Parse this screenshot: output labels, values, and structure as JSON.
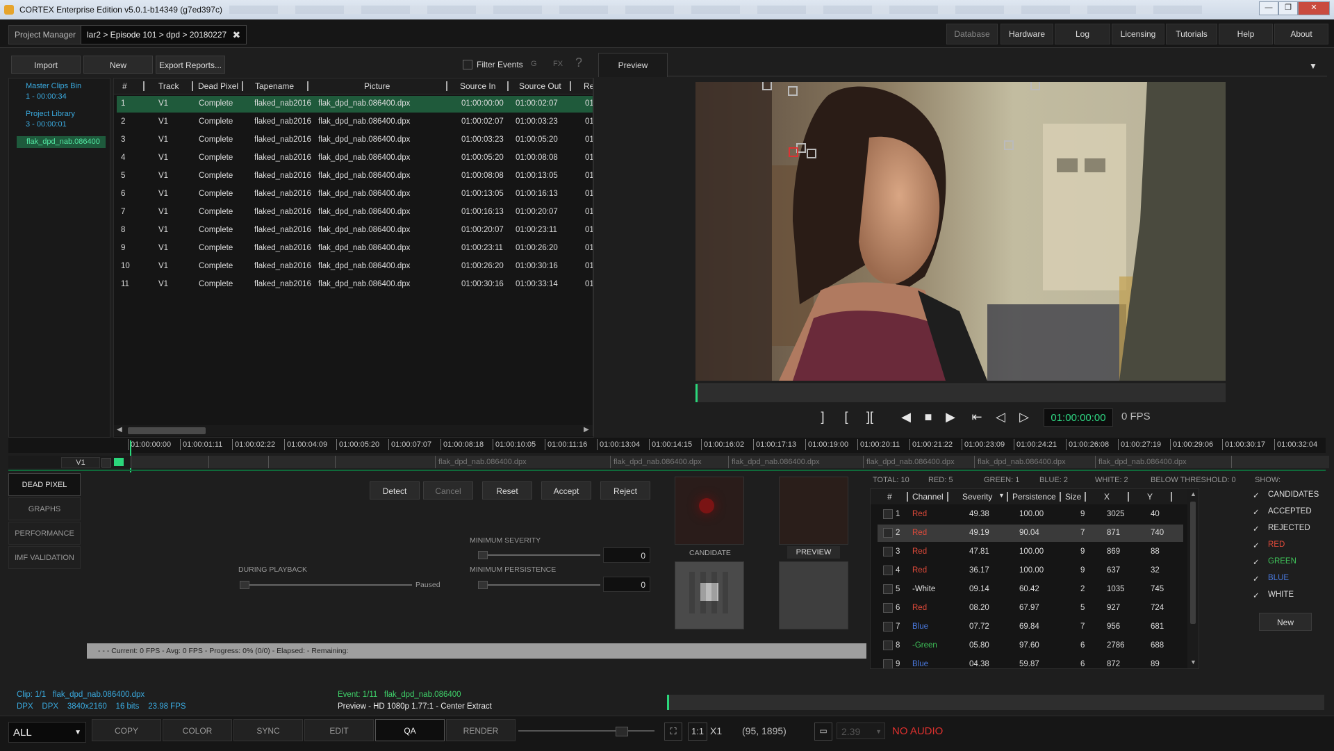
{
  "window": {
    "title": "CORTEX Enterprise Edition v5.0.1-b14349 (g7ed397c)"
  },
  "tabs": {
    "project_manager": "Project Manager",
    "episode": "lar2 > Episode 101 > dpd > 20180227",
    "close": "✖"
  },
  "nav": [
    "Database",
    "Hardware",
    "Log",
    "Licensing",
    "Tutorials",
    "Help",
    "About"
  ],
  "toolbar": {
    "import": "Import",
    "new": "New",
    "export": "Export Reports...",
    "filter_events": "Filter Events",
    "g": "G",
    "fx": "FX",
    "help": "?"
  },
  "bins": [
    {
      "name": "Master Clips Bin",
      "count": "1 - 00:00:34"
    },
    {
      "name": "Project Library",
      "count": "3 - 00:00:01"
    }
  ],
  "selected_bin": "flak_dpd_nab.086400",
  "table": {
    "columns": [
      "#",
      "Track",
      "Dead Pixel",
      "Tapename",
      "Picture",
      "Source In",
      "Source Out",
      "Re"
    ],
    "rows": [
      {
        "n": "1",
        "track": "V1",
        "status": "Complete",
        "tape": "flaked_nab2016",
        "picture": "flak_dpd_nab.086400.dpx",
        "in": "01:00:00:00",
        "out": "01:00:02:07",
        "re": "01:"
      },
      {
        "n": "2",
        "track": "V1",
        "status": "Complete",
        "tape": "flaked_nab2016",
        "picture": "flak_dpd_nab.086400.dpx",
        "in": "01:00:02:07",
        "out": "01:00:03:23",
        "re": "01:"
      },
      {
        "n": "3",
        "track": "V1",
        "status": "Complete",
        "tape": "flaked_nab2016",
        "picture": "flak_dpd_nab.086400.dpx",
        "in": "01:00:03:23",
        "out": "01:00:05:20",
        "re": "01:"
      },
      {
        "n": "4",
        "track": "V1",
        "status": "Complete",
        "tape": "flaked_nab2016",
        "picture": "flak_dpd_nab.086400.dpx",
        "in": "01:00:05:20",
        "out": "01:00:08:08",
        "re": "01:"
      },
      {
        "n": "5",
        "track": "V1",
        "status": "Complete",
        "tape": "flaked_nab2016",
        "picture": "flak_dpd_nab.086400.dpx",
        "in": "01:00:08:08",
        "out": "01:00:13:05",
        "re": "01:"
      },
      {
        "n": "6",
        "track": "V1",
        "status": "Complete",
        "tape": "flaked_nab2016",
        "picture": "flak_dpd_nab.086400.dpx",
        "in": "01:00:13:05",
        "out": "01:00:16:13",
        "re": "01:"
      },
      {
        "n": "7",
        "track": "V1",
        "status": "Complete",
        "tape": "flaked_nab2016",
        "picture": "flak_dpd_nab.086400.dpx",
        "in": "01:00:16:13",
        "out": "01:00:20:07",
        "re": "01:"
      },
      {
        "n": "8",
        "track": "V1",
        "status": "Complete",
        "tape": "flaked_nab2016",
        "picture": "flak_dpd_nab.086400.dpx",
        "in": "01:00:20:07",
        "out": "01:00:23:11",
        "re": "01:"
      },
      {
        "n": "9",
        "track": "V1",
        "status": "Complete",
        "tape": "flaked_nab2016",
        "picture": "flak_dpd_nab.086400.dpx",
        "in": "01:00:23:11",
        "out": "01:00:26:20",
        "re": "01:"
      },
      {
        "n": "10",
        "track": "V1",
        "status": "Complete",
        "tape": "flaked_nab2016",
        "picture": "flak_dpd_nab.086400.dpx",
        "in": "01:00:26:20",
        "out": "01:00:30:16",
        "re": "01:"
      },
      {
        "n": "11",
        "track": "V1",
        "status": "Complete",
        "tape": "flaked_nab2016",
        "picture": "flak_dpd_nab.086400.dpx",
        "in": "01:00:30:16",
        "out": "01:00:33:14",
        "re": "01:"
      }
    ]
  },
  "preview": {
    "tab": "Preview",
    "timecode": "01:00:00:00",
    "fps": "0 FPS",
    "menu": "▼"
  },
  "timeline": {
    "ticks": [
      "01:00:00:00",
      "01:00:01:11",
      "01:00:02:22",
      "01:00:04:09",
      "01:00:05:20",
      "01:00:07:07",
      "01:00:08:18",
      "01:00:10:05",
      "01:00:11:16",
      "01:00:13:04",
      "01:00:14:15",
      "01:00:16:02",
      "01:00:17:13",
      "01:00:19:00",
      "01:00:20:11",
      "01:00:21:22",
      "01:00:23:09",
      "01:00:24:21",
      "01:00:26:08",
      "01:00:27:19",
      "01:00:29:06",
      "01:00:30:17",
      "01:00:32:04"
    ],
    "track": "V1",
    "clip_name": "flak_dpd_nab.086400.dpx"
  },
  "sidetabs": [
    "DEAD PIXEL",
    "GRAPHS",
    "PERFORMANCE",
    "IMF VALIDATION"
  ],
  "qa": {
    "buttons": [
      "Detect",
      "Cancel",
      "Reset",
      "Accept",
      "Reject"
    ],
    "during_playback": "DURING PLAYBACK",
    "paused": "Paused",
    "min_severity": "MINIMUM SEVERITY",
    "min_severity_val": "0",
    "min_persistence": "MINIMUM PERSISTENCE",
    "min_persistence_val": "0",
    "candidate": "CANDIDATE",
    "preview": "PREVIEW",
    "status": "-  -  - Current: 0 FPS - Avg: 0 FPS - Progress: 0% (0/0) - Elapsed:  - Remaining:"
  },
  "summary": {
    "total": "TOTAL: 10",
    "red": "RED: 5",
    "green": "GREEN: 1",
    "blue": "BLUE: 2",
    "white": "WHITE: 2",
    "below": "BELOW THRESHOLD: 0"
  },
  "events": {
    "columns": [
      "#",
      "Channel",
      "Severity",
      "Persistence",
      "Size",
      "X",
      "Y"
    ],
    "rows": [
      {
        "n": "1",
        "ch": "Red",
        "sev": "49.38",
        "per": "100.00",
        "size": "9",
        "x": "3025",
        "y": "40",
        "color": "#e04a3a"
      },
      {
        "n": "2",
        "ch": "Red",
        "sev": "49.19",
        "per": "90.04",
        "size": "7",
        "x": "871",
        "y": "740",
        "color": "#e04a3a"
      },
      {
        "n": "3",
        "ch": "Red",
        "sev": "47.81",
        "per": "100.00",
        "size": "9",
        "x": "869",
        "y": "88",
        "color": "#e04a3a"
      },
      {
        "n": "4",
        "ch": "Red",
        "sev": "36.17",
        "per": "100.00",
        "size": "9",
        "x": "637",
        "y": "32",
        "color": "#e04a3a"
      },
      {
        "n": "5",
        "ch": "-White",
        "sev": "09.14",
        "per": "60.42",
        "size": "2",
        "x": "1035",
        "y": "745",
        "color": "#dddddd"
      },
      {
        "n": "6",
        "ch": "Red",
        "sev": "08.20",
        "per": "67.97",
        "size": "5",
        "x": "927",
        "y": "724",
        "color": "#e04a3a"
      },
      {
        "n": "7",
        "ch": "Blue",
        "sev": "07.72",
        "per": "69.84",
        "size": "7",
        "x": "956",
        "y": "681",
        "color": "#4a7ae0"
      },
      {
        "n": "8",
        "ch": "-Green",
        "sev": "05.80",
        "per": "97.60",
        "size": "6",
        "x": "2786",
        "y": "688",
        "color": "#3fc45a"
      },
      {
        "n": "9",
        "ch": "Blue",
        "sev": "04.38",
        "per": "59.87",
        "size": "6",
        "x": "872",
        "y": "89",
        "color": "#4a7ae0"
      }
    ]
  },
  "show": {
    "label": "SHOW:",
    "items": [
      {
        "label": "CANDIDATES",
        "color": "#dddddd"
      },
      {
        "label": "ACCEPTED",
        "color": "#dddddd"
      },
      {
        "label": "REJECTED",
        "color": "#dddddd"
      },
      {
        "label": "RED",
        "color": "#e04a3a"
      },
      {
        "label": "GREEN",
        "color": "#3fc45a"
      },
      {
        "label": "BLUE",
        "color": "#4a7ae0"
      },
      {
        "label": "WHITE",
        "color": "#dddddd"
      }
    ],
    "new": "New"
  },
  "clipinfo": {
    "clip": "Clip: 1/1   flak_dpd_nab.086400.dpx",
    "format": "DPX    DPX    3840x2160    16 bits    23.98 FPS",
    "event": "Event: 1/11   flak_dpd_nab.086400",
    "preview": "Preview - HD 1080p 1.77:1 - Center Extract"
  },
  "bottom": {
    "filter": "ALL",
    "tabs": [
      "COPY",
      "COLOR",
      "SYNC",
      "EDIT",
      "QA",
      "RENDER"
    ],
    "zoom": "1:1",
    "x1": "X1",
    "coords": "(95, 1895)",
    "aspect": "2.39",
    "audio": "NO AUDIO"
  }
}
